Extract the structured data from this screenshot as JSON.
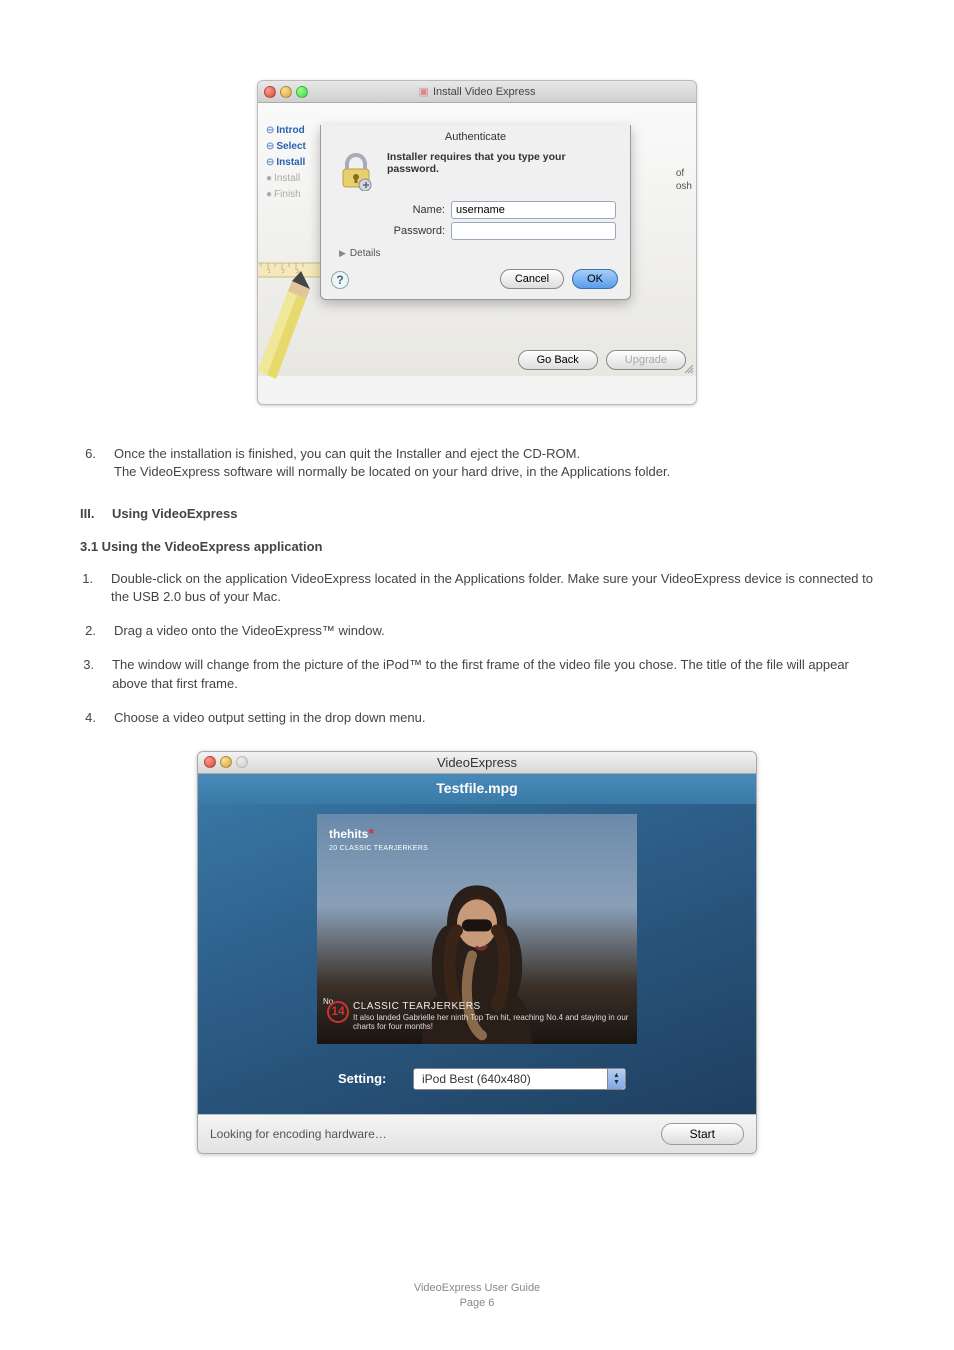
{
  "installer": {
    "window_title": "Install Video Express",
    "auth_subtitle": "Authenticate",
    "auth_prompt": "Installer requires that you type your password.",
    "name_label": "Name:",
    "name_value": "username",
    "password_label": "Password:",
    "password_value": "",
    "details_label": "Details",
    "help_label": "?",
    "cancel_label": "Cancel",
    "ok_label": "OK",
    "go_back_label": "Go Back",
    "upgrade_label": "Upgrade",
    "right_edge_1": "of",
    "right_edge_2": "osh",
    "steps": [
      {
        "label": "Introd",
        "state": "active"
      },
      {
        "label": "Select",
        "state": "active"
      },
      {
        "label": "Install",
        "state": "active"
      },
      {
        "label": "Install",
        "state": "dim"
      },
      {
        "label": "Finish",
        "state": "dim"
      }
    ]
  },
  "doc": {
    "item6_text": "Once the installation is finished, you can quit the Installer and eject the CD-ROM.\nThe VideoExpress software will normally be located on your hard drive, in the Applications folder.",
    "section_roman": "III.",
    "section_title": "Using VideoExpress",
    "subsection": "3.1  Using the VideoExpress application",
    "item1": "Double-click on the application VideoExpress located in the Applications folder. Make sure your VideoExpress device is connected to the USB 2.0 bus of your Mac.",
    "item2": "Drag a video onto the VideoExpress™ window.",
    "item3": "The window will change from the picture of the iPod™ to the first frame of the video file you chose. The title of the file will appear above that first frame.",
    "item4": "Choose a video output setting in the drop down menu."
  },
  "ve": {
    "window_title": "VideoExpress",
    "filename": "Testfile.mpg",
    "logo_main": "thehits",
    "logo_sub": "20 CLASSIC TEARJERKERS",
    "rank_no_label": "No",
    "rank_number": "14",
    "lower_third_title": "CLASSIC TEARJERKERS",
    "lower_third_sub": "It also landed Gabrielle her ninth Top Ten hit, reaching No.4 and staying in our charts for four months!",
    "setting_label": "Setting:",
    "setting_value": "iPod Best (640x480)",
    "status_text": "Looking for encoding hardware…",
    "start_label": "Start"
  },
  "footer": {
    "line1": "VideoExpress User Guide",
    "line2": "Page 6"
  }
}
